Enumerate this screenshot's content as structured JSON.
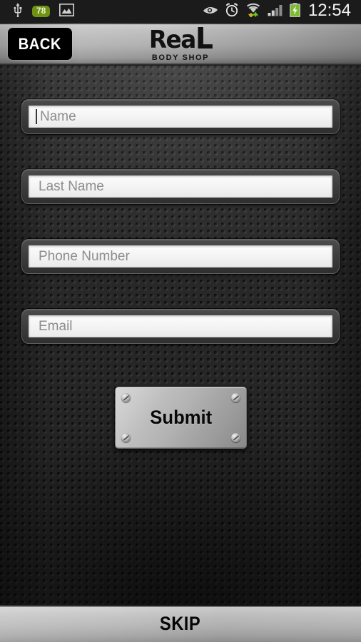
{
  "statusbar": {
    "time": "12:54",
    "battery_badge": "78",
    "icons": {
      "usb": "usb-icon",
      "gallery": "image-icon",
      "eye": "eye-icon",
      "alarm": "alarm-clock-icon",
      "wifi": "wifi-transfer-icon",
      "signal": "cell-signal-icon",
      "battery": "battery-charging-icon"
    }
  },
  "header": {
    "back_label": "BACK",
    "logo_main": "Rea",
    "logo_main_tail": "L",
    "logo_sub": "BODY SHOP"
  },
  "form": {
    "fields": [
      {
        "name": "first-name",
        "placeholder": "Name",
        "value": "",
        "focused": true
      },
      {
        "name": "last-name",
        "placeholder": "Last Name",
        "value": "",
        "focused": false
      },
      {
        "name": "phone-number",
        "placeholder": "Phone Number",
        "value": "",
        "focused": false
      },
      {
        "name": "email",
        "placeholder": "Email",
        "value": "",
        "focused": false
      }
    ],
    "submit_label": "Submit"
  },
  "footer": {
    "skip_label": "SKIP"
  },
  "colors": {
    "status_bar_bg": "#1b1b1b",
    "badge_green": "#6f9214",
    "mesh_bg": "#2b2b2b",
    "metal_light": "#c9c9c9",
    "metal_dark": "#8e8e8e",
    "text_dark": "#0a0a0a",
    "placeholder_gray": "#8d8d8d"
  }
}
